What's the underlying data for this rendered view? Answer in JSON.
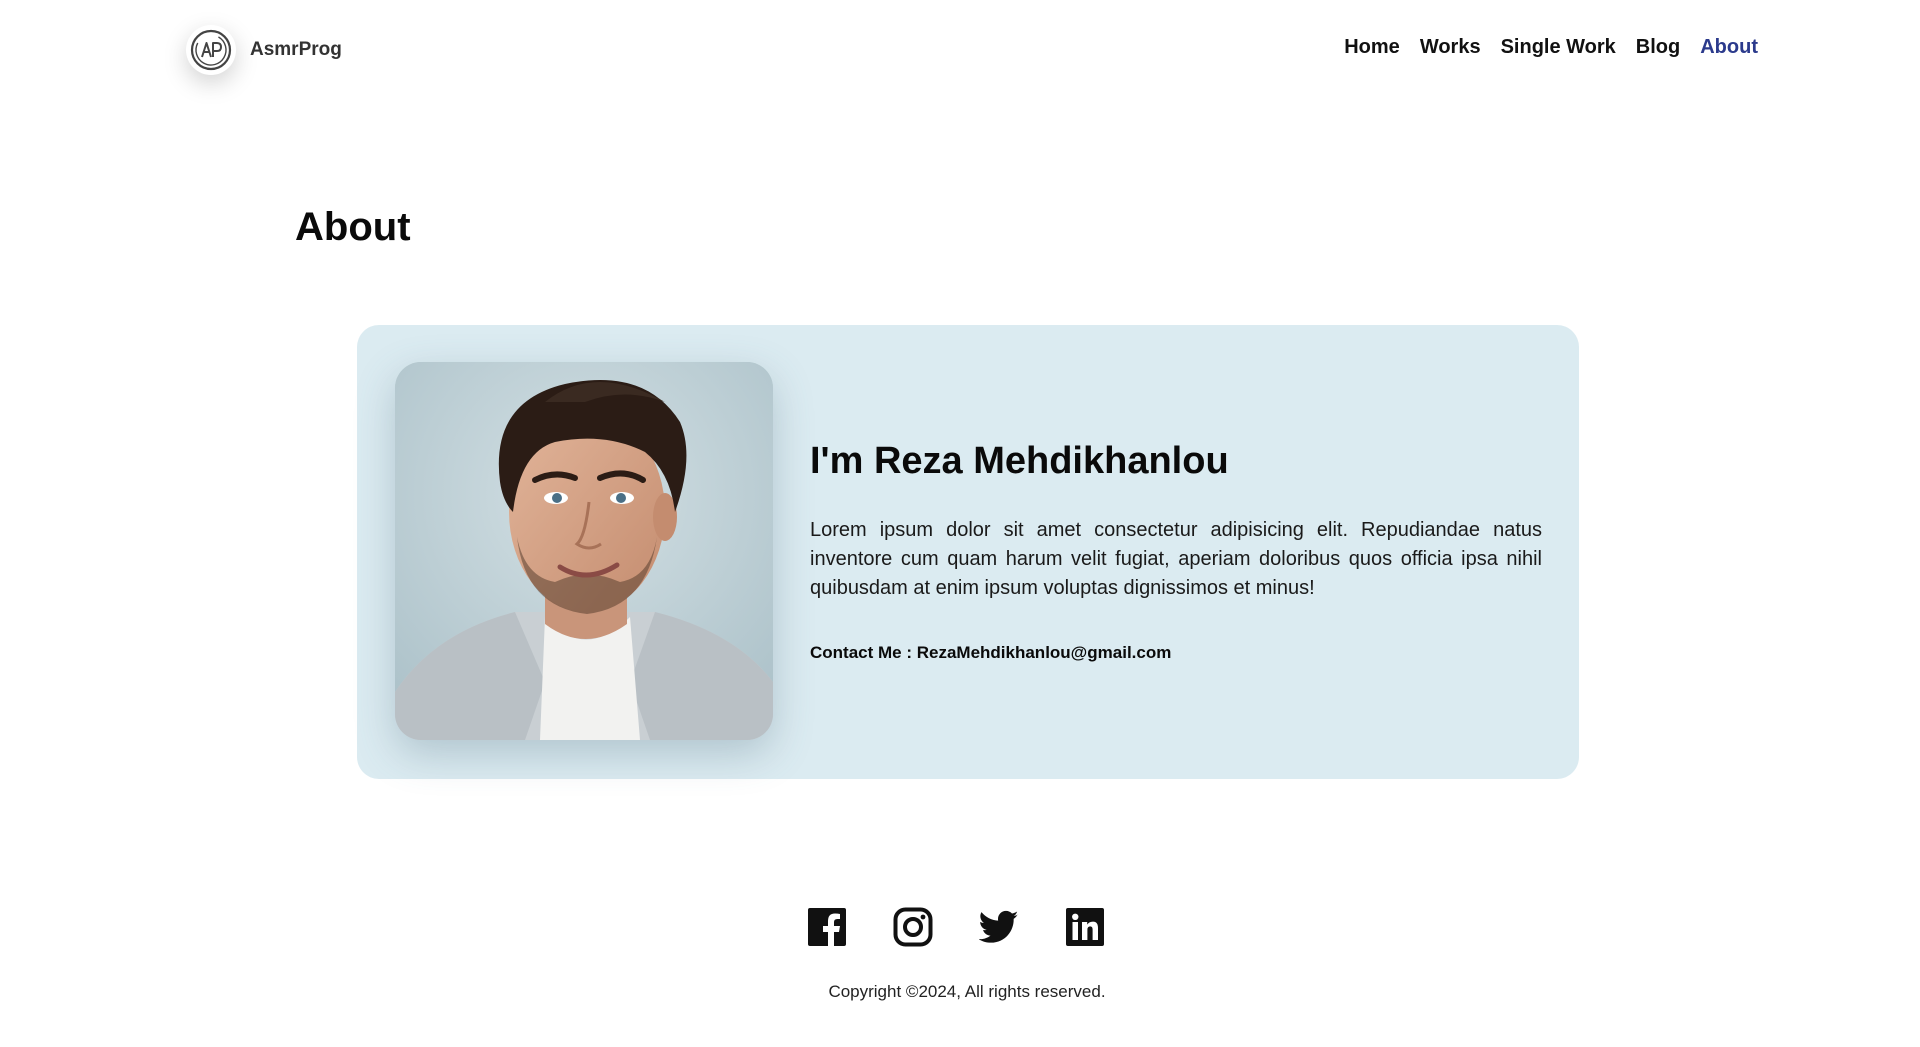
{
  "brand": {
    "name": "AsmrProg",
    "logo_icon": "ap-monogram-icon"
  },
  "nav": {
    "items": [
      {
        "label": "Home"
      },
      {
        "label": "Works"
      },
      {
        "label": "Single Work"
      },
      {
        "label": "Blog"
      },
      {
        "label": "About",
        "active": true
      }
    ],
    "active_color": "#2b3a8c"
  },
  "page": {
    "title": "About"
  },
  "profile": {
    "heading": "I'm Reza Mehdikhanlou",
    "bio": "Lorem ipsum dolor sit amet consectetur adipisicing elit. Repudiandae natus inventore cum quam harum velit fugiat, aperiam doloribus quos officia ipsa nihil quibusdam at enim ipsum voluptas dignissimos et minus!",
    "contact": "Contact Me : RezaMehdikhanlou@gmail.com",
    "card_color": "#dbebf1"
  },
  "footer": {
    "social_icons": [
      "facebook-icon",
      "instagram-icon",
      "twitter-icon",
      "linkedin-icon"
    ],
    "copyright": "Copyright ©2024, All rights reserved."
  }
}
